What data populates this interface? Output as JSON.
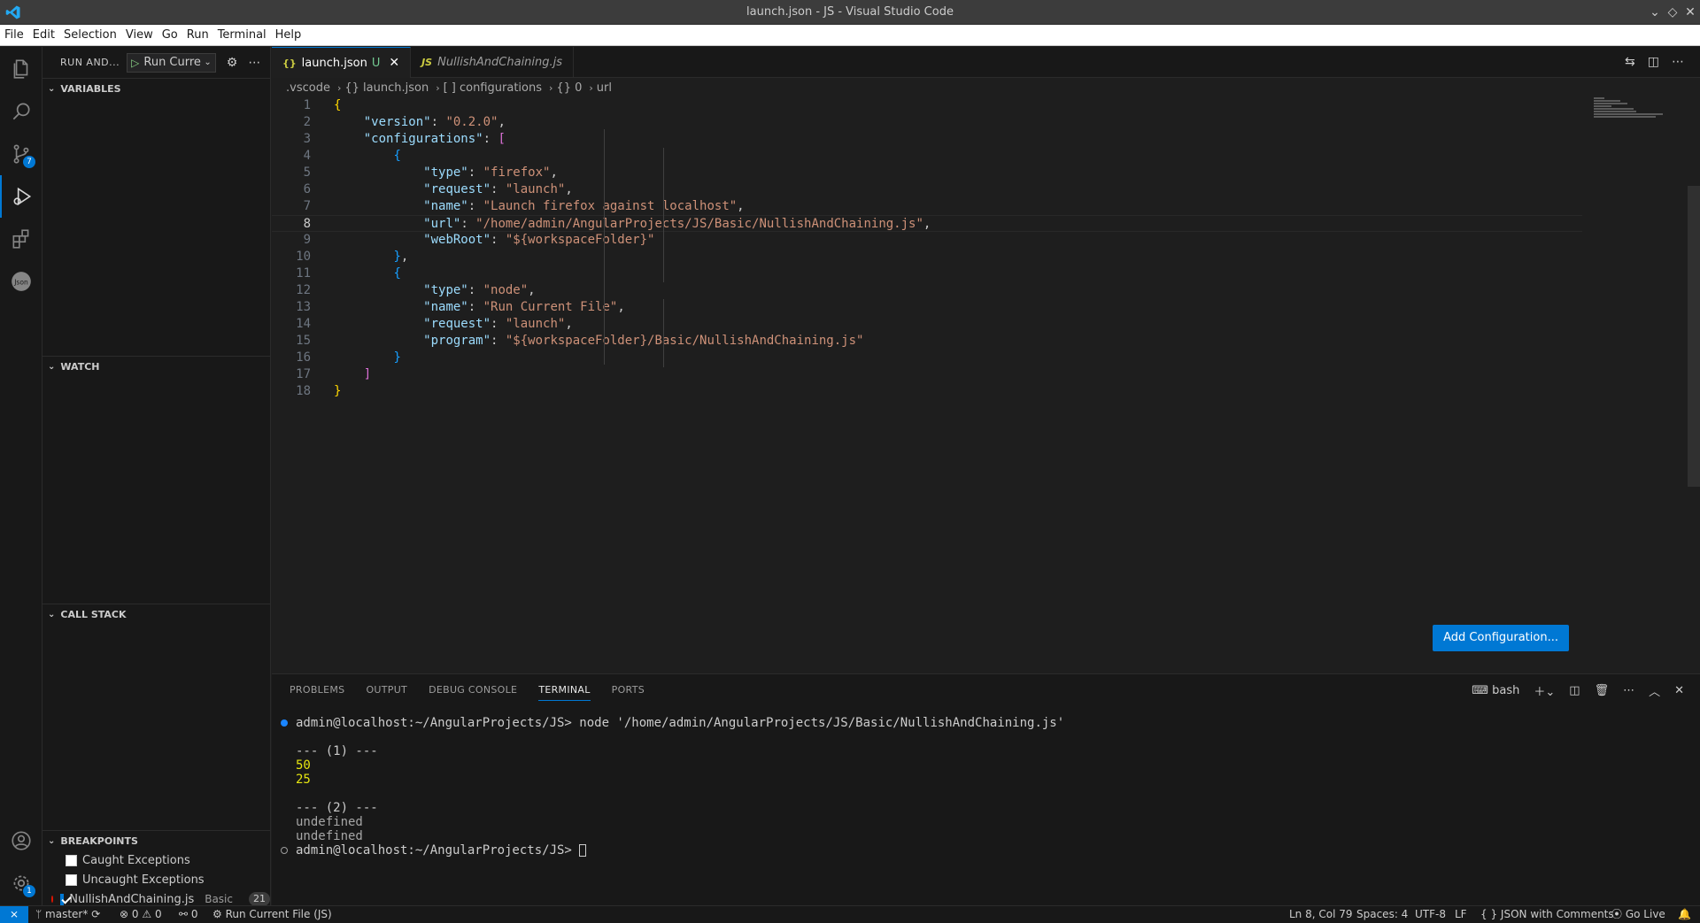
{
  "window": {
    "title": "launch.json - JS - Visual Studio Code"
  },
  "menu": [
    "File",
    "Edit",
    "Selection",
    "View",
    "Go",
    "Run",
    "Terminal",
    "Help"
  ],
  "activity": {
    "scm_badge": "7",
    "settings_badge": "1"
  },
  "sidebar": {
    "title": "RUN AND...",
    "run_config": "Run Current File",
    "sections": {
      "variables": "VARIABLES",
      "watch": "WATCH",
      "call_stack": "CALL STACK",
      "breakpoints": "BREAKPOINTS"
    },
    "breakpoints": [
      {
        "label": "Caught Exceptions",
        "checked": false
      },
      {
        "label": "Uncaught Exceptions",
        "checked": false
      },
      {
        "label": "NullishAndChaining.js",
        "checked": true,
        "desc": "Basic",
        "count": "21"
      }
    ]
  },
  "tabs": [
    {
      "icon": "{}",
      "label": "launch.json",
      "status": "U",
      "active": true
    },
    {
      "icon": "JS",
      "label": "NullishAndChaining.js",
      "active": false
    }
  ],
  "breadcrumb": [
    ".vscode",
    "{} launch.json",
    "[ ] configurations",
    "{} 0",
    "url"
  ],
  "code_lines": [
    {
      "n": "1",
      "parts": [
        [
          "b1",
          "{"
        ]
      ]
    },
    {
      "n": "2",
      "parts": [
        [
          "p",
          "    "
        ],
        [
          "k",
          "\"version\""
        ],
        [
          "p",
          ": "
        ],
        [
          "s",
          "\"0.2.0\""
        ],
        [
          "p",
          ","
        ]
      ]
    },
    {
      "n": "3",
      "parts": [
        [
          "p",
          "    "
        ],
        [
          "k",
          "\"configurations\""
        ],
        [
          "p",
          ": "
        ],
        [
          "b2",
          "["
        ]
      ]
    },
    {
      "n": "4",
      "parts": [
        [
          "p",
          "        "
        ],
        [
          "b3",
          "{"
        ]
      ]
    },
    {
      "n": "5",
      "parts": [
        [
          "p",
          "            "
        ],
        [
          "k",
          "\"type\""
        ],
        [
          "p",
          ": "
        ],
        [
          "s",
          "\"firefox\""
        ],
        [
          "p",
          ","
        ]
      ]
    },
    {
      "n": "6",
      "parts": [
        [
          "p",
          "            "
        ],
        [
          "k",
          "\"request\""
        ],
        [
          "p",
          ": "
        ],
        [
          "s",
          "\"launch\""
        ],
        [
          "p",
          ","
        ]
      ]
    },
    {
      "n": "7",
      "parts": [
        [
          "p",
          "            "
        ],
        [
          "k",
          "\"name\""
        ],
        [
          "p",
          ": "
        ],
        [
          "s",
          "\"Launch firefox against localhost\""
        ],
        [
          "p",
          ","
        ]
      ]
    },
    {
      "n": "8",
      "parts": [
        [
          "p",
          "            "
        ],
        [
          "k",
          "\"url\""
        ],
        [
          "p",
          ": "
        ],
        [
          "s",
          "\"/home/admin/AngularProjects/JS/Basic/NullishAndChaining.js\""
        ],
        [
          "p",
          ","
        ]
      ]
    },
    {
      "n": "9",
      "parts": [
        [
          "p",
          "            "
        ],
        [
          "k",
          "\"webRoot\""
        ],
        [
          "p",
          ": "
        ],
        [
          "s",
          "\"${workspaceFolder}\""
        ]
      ]
    },
    {
      "n": "10",
      "parts": [
        [
          "p",
          "        "
        ],
        [
          "b3",
          "}"
        ],
        [
          "p",
          ","
        ]
      ]
    },
    {
      "n": "11",
      "parts": [
        [
          "p",
          "        "
        ],
        [
          "b3",
          "{"
        ]
      ]
    },
    {
      "n": "12",
      "parts": [
        [
          "p",
          "            "
        ],
        [
          "k",
          "\"type\""
        ],
        [
          "p",
          ": "
        ],
        [
          "s",
          "\"node\""
        ],
        [
          "p",
          ","
        ]
      ]
    },
    {
      "n": "13",
      "parts": [
        [
          "p",
          "            "
        ],
        [
          "k",
          "\"name\""
        ],
        [
          "p",
          ": "
        ],
        [
          "s",
          "\"Run Current File\""
        ],
        [
          "p",
          ","
        ]
      ]
    },
    {
      "n": "14",
      "parts": [
        [
          "p",
          "            "
        ],
        [
          "k",
          "\"request\""
        ],
        [
          "p",
          ": "
        ],
        [
          "s",
          "\"launch\""
        ],
        [
          "p",
          ","
        ]
      ]
    },
    {
      "n": "15",
      "parts": [
        [
          "p",
          "            "
        ],
        [
          "k",
          "\"program\""
        ],
        [
          "p",
          ": "
        ],
        [
          "s",
          "\"${workspaceFolder}/Basic/NullishAndChaining.js\""
        ]
      ]
    },
    {
      "n": "16",
      "parts": [
        [
          "p",
          "        "
        ],
        [
          "b3",
          "}"
        ]
      ]
    },
    {
      "n": "17",
      "parts": [
        [
          "p",
          "    "
        ],
        [
          "b2",
          "]"
        ]
      ]
    },
    {
      "n": "18",
      "parts": [
        [
          "b1",
          "}"
        ]
      ]
    }
  ],
  "current_line": "8",
  "add_config_label": "Add Configuration...",
  "panel": {
    "tabs": [
      "PROBLEMS",
      "OUTPUT",
      "DEBUG CONSOLE",
      "TERMINAL",
      "PORTS"
    ],
    "active_tab": "TERMINAL",
    "shell": "bash",
    "terminal_lines": [
      {
        "text": "admin@localhost:~/AngularProjects/JS> node '/home/admin/AngularProjects/JS/Basic/NullishAndChaining.js'",
        "marker": "blue",
        "style": ""
      },
      {
        "text": "",
        "marker": "",
        "style": ""
      },
      {
        "text": "--- (1) ---",
        "marker": "",
        "style": ""
      },
      {
        "text": "50",
        "marker": "",
        "style": "y"
      },
      {
        "text": "25",
        "marker": "",
        "style": "y"
      },
      {
        "text": "",
        "marker": "",
        "style": ""
      },
      {
        "text": "--- (2) ---",
        "marker": "",
        "style": ""
      },
      {
        "text": "undefined",
        "marker": "",
        "style": "g"
      },
      {
        "text": "undefined",
        "marker": "",
        "style": "g"
      },
      {
        "text": "admin@localhost:~/AngularProjects/JS> ",
        "marker": "hollow",
        "style": "",
        "cursor": true
      }
    ]
  },
  "status": {
    "branch": "master*",
    "errors": "0",
    "warnings": "0",
    "ports": "0",
    "run_target": "Run Current File (JS)",
    "position": "Ln 8, Col 79",
    "spaces": "Spaces: 4",
    "encoding": "UTF-8",
    "eol": "LF",
    "language": "JSON with Comments",
    "go_live": "Go Live"
  },
  "colors": {
    "accent": "#0078d4",
    "bg": "#1e1e1e",
    "sidebar_bg": "#181818"
  }
}
